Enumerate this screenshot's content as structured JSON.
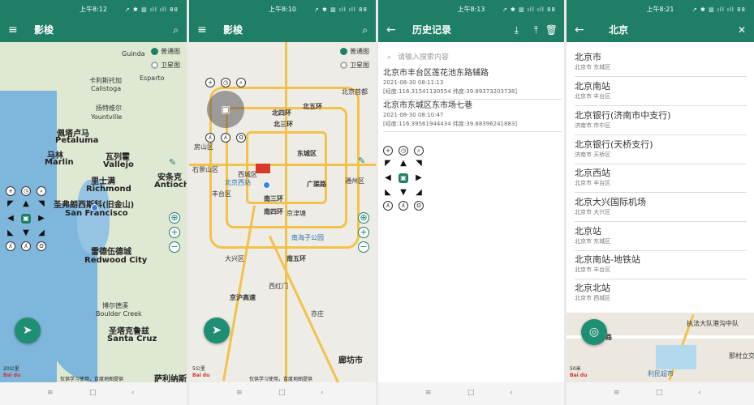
{
  "p1": {
    "status_time": "上午8:12",
    "status_icons": "➚ ✱ ▥ ıll ıll 88",
    "title": "影梭",
    "menu_icon": "menu-icon",
    "search_icon": "search-icon",
    "layers": [
      "普通图",
      "卫星图"
    ],
    "labels": {
      "guinda": "Guinda",
      "esparto": "Esparto",
      "kapiwa": "卡利斯托加",
      "calistoga": "Calistoga",
      "yountville": "扬特维尔",
      "yountville_en": "Yountville",
      "petaluma_cn": "佩塔卢马",
      "petaluma": "Petaluma",
      "marlin_cn": "马林",
      "marlin": "Marlin",
      "vallejo_cn": "瓦列霍",
      "vallejo": "Vallejo",
      "richmond_cn": "里士满",
      "richmond": "Richmond",
      "sf_cn": "圣弗朗西斯科(旧金山)",
      "sf": "San Francisco",
      "antioch_cn": "安条克",
      "antioch": "Antioch",
      "redwood_cn": "雷德伍德城",
      "redwood": "Redwood City",
      "boulder_cn": "博尔德溪",
      "boulder": "Boulder Creek",
      "santacruz_cn": "圣塔克鲁兹",
      "santacruz": "Santa Cruz",
      "salinas": "萨利纳斯"
    },
    "scale": "20公里",
    "footer": "仅供学习使用，百度地图提供"
  },
  "p2": {
    "status_time": "上午8:10",
    "status_icons": "➚ ✱ ▥ ıll ıll 88",
    "title": "影梭",
    "layers": [
      "普通图",
      "卫星图"
    ],
    "labels": {
      "north5": "北五环",
      "north4": "北四环",
      "north3": "北三环",
      "dongcheng": "东城区",
      "shijingshan": "石景山区",
      "xicheng": "西城区",
      "fengtai": "丰台区",
      "beijingxi": "北京西站",
      "south3": "南三环",
      "south4": "南四环",
      "guangqu": "广渠路",
      "tongzhou": "通州区",
      "daxing": "大兴区",
      "jingzuan": "京津塘",
      "zhuhai": "南海子公园",
      "south5": "南五环",
      "langfang": "廊坊市",
      "fangshan": "房山区",
      "dongchen2": "北京首都",
      "xihongmen": "西红门",
      "yizhuang": "亦庄",
      "jinghu": "京沪高速"
    },
    "scale": "5公里",
    "footer": "仅供学习使用，百度地图提供"
  },
  "p3": {
    "status_time": "上午8:13",
    "title": "历史记录",
    "search_placeholder": "请输入搜索内容",
    "history": [
      {
        "name": "北京市丰台区莲花池东路辅路",
        "time": "2021-08-30 08:11:13",
        "coord": "[经度:116.31541130554 纬度:39.89373203738]"
      },
      {
        "name": "北京市东城区东市场七巷",
        "time": "2021-08-30 08:10:47",
        "coord": "[经度:116.39561944434 纬度:39.88396241883]"
      }
    ]
  },
  "p4": {
    "status_time": "上午8:21",
    "title": "北京",
    "results": [
      {
        "name": "北京市",
        "sub": "北京市 东城区"
      },
      {
        "name": "北京南站",
        "sub": "北京市 丰台区"
      },
      {
        "name": "北京银行(济南市中支行)",
        "sub": "济南市 市中区"
      },
      {
        "name": "北京银行(天桥支行)",
        "sub": "济南市 天桥区"
      },
      {
        "name": "北京西站",
        "sub": "北京市 丰台区"
      },
      {
        "name": "北京大兴国际机场",
        "sub": "北京市 大兴区"
      },
      {
        "name": "北京站",
        "sub": "北京市 东城区"
      },
      {
        "name": "北京南站-地铁站",
        "sub": "北京市 丰台区"
      },
      {
        "name": "北京北站",
        "sub": "北京市 西城区"
      }
    ],
    "map_labels": {
      "street": "十路",
      "exec": "执法大队港沟中队",
      "mall": "利民超市",
      "town": "那村立交",
      "scale": "50米"
    }
  },
  "nav": {
    "menu": "≡",
    "home": "□",
    "back": "‹"
  }
}
